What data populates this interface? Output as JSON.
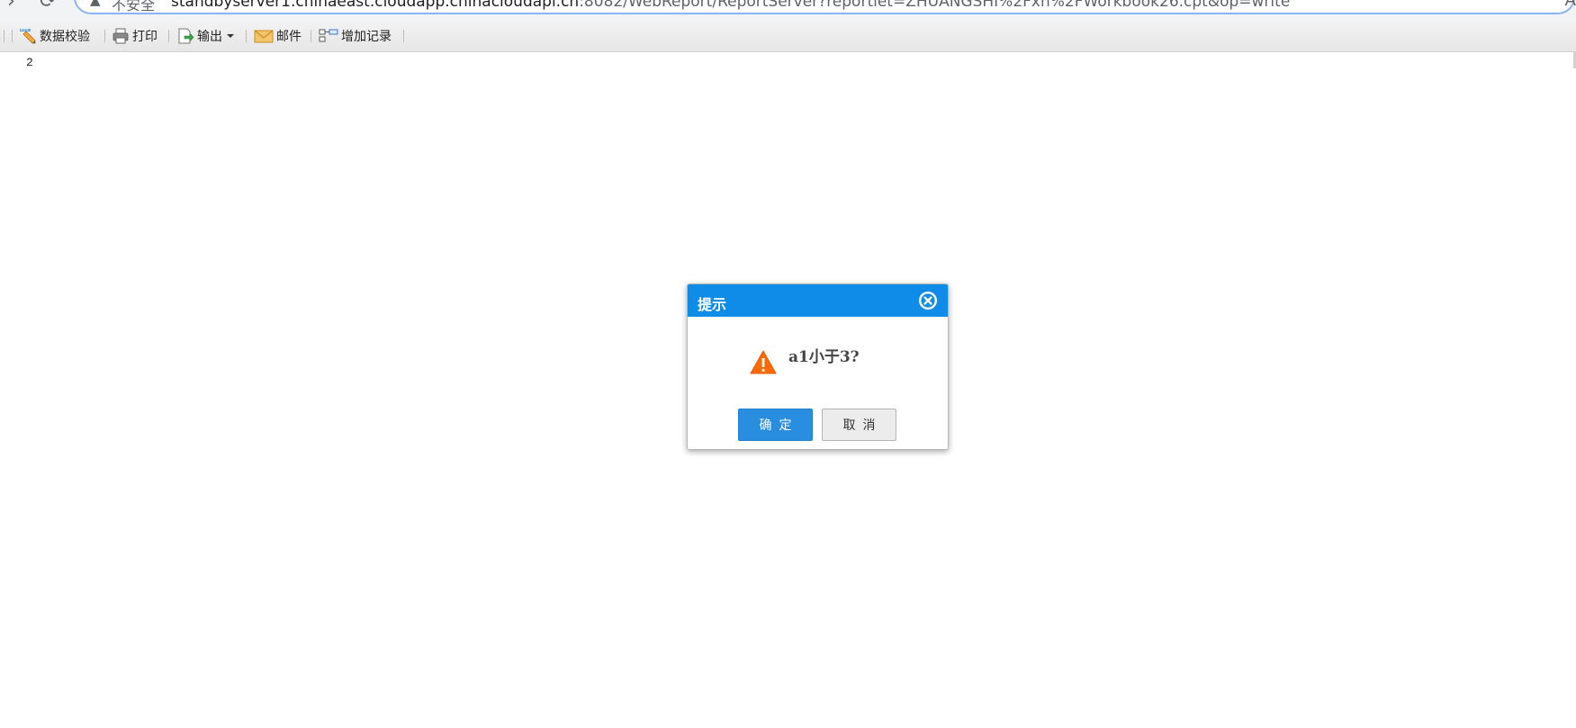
{
  "browser": {
    "security_label": "不安全",
    "url_host": "standbyserver1.chinaeast.cloudapp.chinacloudapi.cn",
    "url_rest": ":8082/WebReport/ReportServer?reportlet=ZHUANGSHI%2Fxh%2FWorkbook26.cpt&op=write"
  },
  "toolbar": {
    "items": [
      {
        "label": "数据校验",
        "icon": "pencil-ruler-icon"
      },
      {
        "label": "打印",
        "icon": "printer-icon"
      },
      {
        "label": "输出",
        "icon": "export-icon"
      },
      {
        "label": "邮件",
        "icon": "mail-icon"
      },
      {
        "label": "增加记录",
        "icon": "add-record-icon"
      }
    ]
  },
  "sheet": {
    "cell_value": "2"
  },
  "dialog": {
    "title": "提示",
    "message": "a1小于3?",
    "ok_label": "确定",
    "cancel_label": "取消",
    "header_color": "#0f8ce8",
    "icon": "warning-triangle-icon"
  }
}
